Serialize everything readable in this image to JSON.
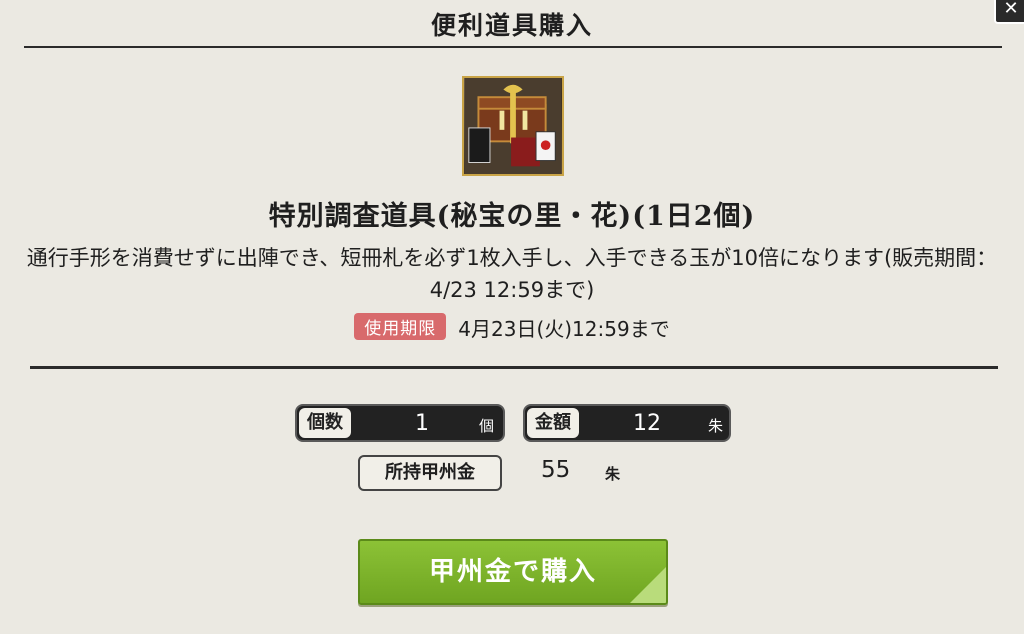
{
  "header": {
    "title": "便利道具購入",
    "close_label": "✕"
  },
  "item": {
    "icon": "treasure-box-icon",
    "name": "特別調査道具(秘宝の里・花)(1日2個)",
    "description": "通行手形を消費せずに出陣でき、短冊札を必ず1枚入手し、入手できる玉が10倍になります(販売期間：4/23 12:59まで)",
    "expiry_badge": "使用期限",
    "expiry_text": "4月23日(火)12:59まで"
  },
  "purchase": {
    "quantity_label": "個数",
    "quantity_value": "1",
    "quantity_unit": "個",
    "price_label": "金額",
    "price_value": "12",
    "price_unit": "朱",
    "owned_label": "所持甲州金",
    "owned_value": "55",
    "owned_unit": "朱",
    "buy_button": "甲州金で購入"
  },
  "colors": {
    "background": "#ebe9e2",
    "badge": "#d86a6c",
    "button": "#7cb42c"
  }
}
